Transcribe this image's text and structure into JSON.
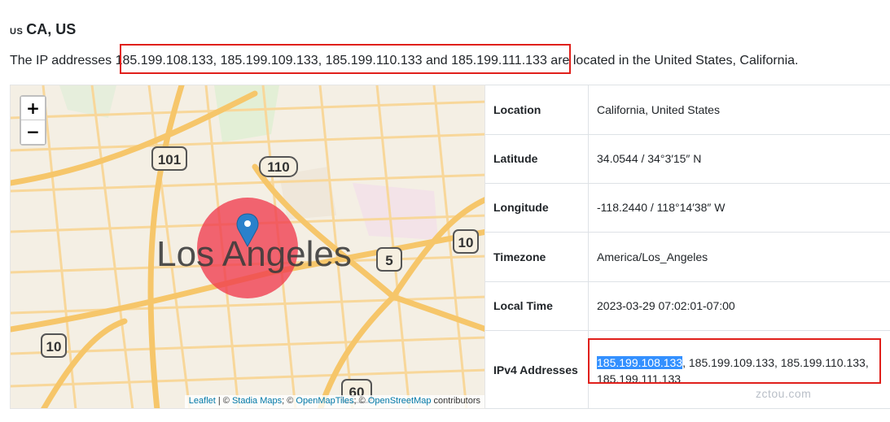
{
  "heading": {
    "flag": "US",
    "title": "CA, US"
  },
  "intro": {
    "prefix": "The IP addresses ",
    "ips": "185.199.108.133, 185.199.109.133, 185.199.110.133 and 185.199.111.133",
    "suffix": " are located in the United States, California."
  },
  "map": {
    "city_label": "Los Angeles",
    "shields": [
      "101",
      "110",
      "10",
      "5",
      "10",
      "60"
    ],
    "zoom_in": "+",
    "zoom_out": "−",
    "attribution": {
      "leaflet": "Leaflet",
      "sep1": " | © ",
      "stadia": "Stadia Maps",
      "sep2": "; © ",
      "omt": "OpenMapTiles",
      "sep3": "; © ",
      "osm": "OpenStreetMap",
      "tail": " contributors"
    },
    "colors": {
      "marker": "#2a81cb",
      "circle": "#f03b4e",
      "road": "#f6c66a"
    }
  },
  "info": {
    "rows": [
      {
        "label": "Location",
        "value": "California, United States"
      },
      {
        "label": "Latitude",
        "value": "34.0544 / 34°3′15″ N"
      },
      {
        "label": "Longitude",
        "value": "-118.2440 / 118°14′38″ W"
      },
      {
        "label": "Timezone",
        "value": "America/Los_Angeles"
      },
      {
        "label": "Local Time",
        "value": "2023-03-29 07:02:01-07:00"
      },
      {
        "label": "IPv4 Addresses",
        "value_selected": "185.199.108.133",
        "value_rest": ", 185.199.109.133, 185.199.110.133,",
        "value_line2": "185.199.111.133"
      }
    ]
  },
  "watermark": "zctou.com"
}
